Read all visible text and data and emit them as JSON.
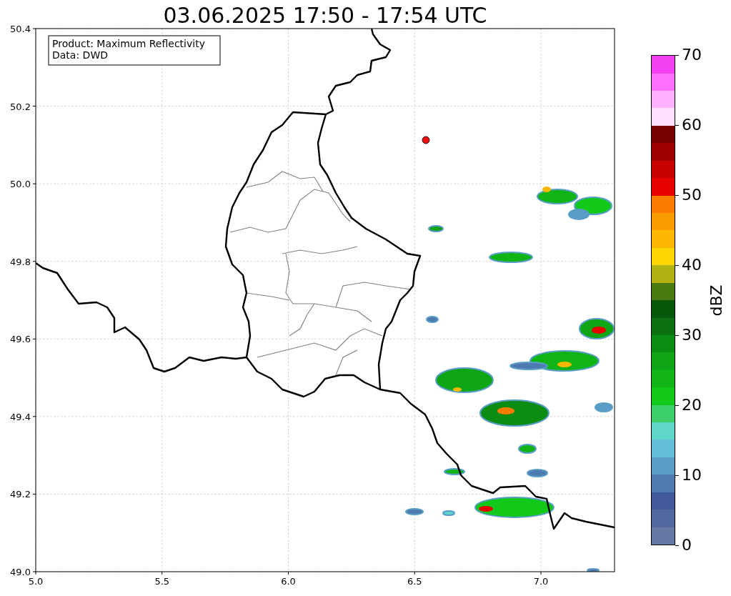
{
  "title": "03.06.2025 17:50 - 17:54 UTC",
  "legend": [
    "Product: Maximum Reflectivity",
    "Data: DWD"
  ],
  "map": {
    "x_axis_labels": [
      "5.0",
      "5.5",
      "6.0",
      "6.5",
      "7.0"
    ],
    "y_axis_labels": [
      "50.4",
      "50.2",
      "50.0",
      "49.8",
      "49.6",
      "49.4",
      "49.2",
      "49.0"
    ]
  },
  "colorbar": {
    "label": "dBZ",
    "ticks": [
      "70",
      "60",
      "50",
      "40",
      "30",
      "20",
      "10",
      "0"
    ]
  }
}
